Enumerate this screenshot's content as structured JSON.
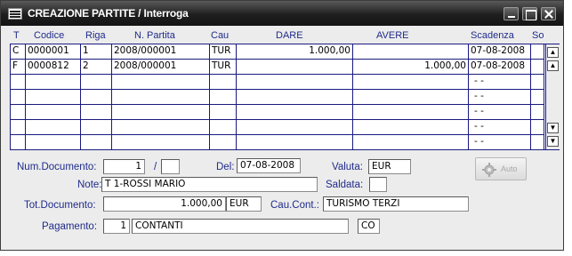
{
  "window": {
    "title": "CREAZIONE PARTITE / Interroga"
  },
  "grid": {
    "columns": [
      "T",
      "Codice",
      "Riga",
      "N. Partita",
      "Cau",
      "DARE",
      "AVERE",
      "Scadenza",
      "So"
    ],
    "rows": [
      {
        "T": "C",
        "Codice": "0000001",
        "Riga": "1",
        "NPartita": "2008/000001",
        "Cau": "TUR",
        "Dare": "1.000,00",
        "Avere": "",
        "Scadenza": "07-08-2008"
      },
      {
        "T": "F",
        "Codice": "0000812",
        "Riga": "2",
        "NPartita": "2008/000001",
        "Cau": "TUR",
        "Dare": "",
        "Avere": "1.000,00",
        "Scadenza": "07-08-2008"
      },
      {
        "T": "",
        "Codice": "",
        "Riga": "",
        "NPartita": "",
        "Cau": "",
        "Dare": "",
        "Avere": "",
        "Scadenza": "- -"
      },
      {
        "T": "",
        "Codice": "",
        "Riga": "",
        "NPartita": "",
        "Cau": "",
        "Dare": "",
        "Avere": "",
        "Scadenza": "- -"
      },
      {
        "T": "",
        "Codice": "",
        "Riga": "",
        "NPartita": "",
        "Cau": "",
        "Dare": "",
        "Avere": "",
        "Scadenza": "- -"
      },
      {
        "T": "",
        "Codice": "",
        "Riga": "",
        "NPartita": "",
        "Cau": "",
        "Dare": "",
        "Avere": "",
        "Scadenza": "- -"
      },
      {
        "T": "",
        "Codice": "",
        "Riga": "",
        "NPartita": "",
        "Cau": "",
        "Dare": "",
        "Avere": "",
        "Scadenza": "- -"
      }
    ]
  },
  "form": {
    "num_documento_label": "Num.Documento:",
    "num_documento": "1",
    "slash": "/",
    "num_documento_suffix": "",
    "del_label": "Del:",
    "del_date": "07-08-2008",
    "valuta_label": "Valuta:",
    "valuta": "EUR",
    "note_label": "Note:",
    "note": "T    1-ROSSI MARIO",
    "saldata_label": "Saldata:",
    "saldata": "",
    "tot_documento_label": "Tot.Documento:",
    "tot_documento": "1.000,00",
    "tot_valuta": "EUR",
    "cau_cont_label": "Cau.Cont.:",
    "cau_cont": "TURISMO TERZI",
    "pagamento_label": "Pagamento:",
    "pagamento_code": "1",
    "pagamento_desc": "CONTANTI",
    "pagamento_extra": "CO",
    "auto_button": "Auto"
  },
  "icons": [
    "app-icon",
    "minimize-icon",
    "maximize-icon",
    "close-icon",
    "gear-icon",
    "scroll-up-icon",
    "scroll-down-icon"
  ]
}
